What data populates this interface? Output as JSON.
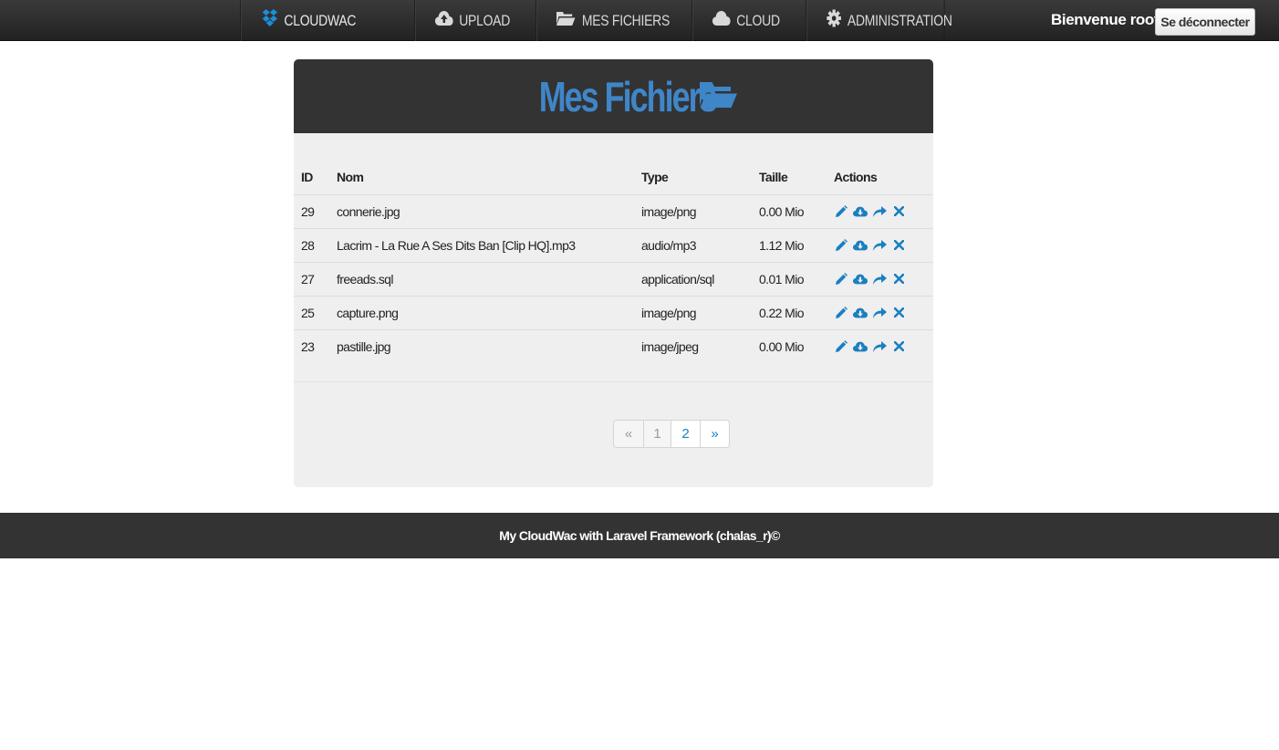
{
  "nav": {
    "brand": "CLOUDWAC",
    "items": [
      {
        "label": "UPLOAD",
        "icon": "cloud-upload-icon"
      },
      {
        "label": "MES FICHIERS",
        "icon": "folder-open-icon"
      },
      {
        "label": "CLOUD",
        "icon": "cloud-icon"
      },
      {
        "label": "ADMINISTRATION",
        "icon": "gear-icon"
      }
    ],
    "welcome": "Bienvenue root",
    "logout_label": "Se déconnecter"
  },
  "colors": {
    "navbar_bg": "#2b2b2b",
    "accent_blue": "#3f86c9",
    "action_blue": "#1a7fc1",
    "brand_blue": "#1a8fd8",
    "panel_bg": "#efefef",
    "header_bg": "#333333"
  },
  "page": {
    "title": "Mes Fichiers",
    "title_icon": "folder-open-icon"
  },
  "table": {
    "headers": [
      "ID",
      "Nom",
      "Type",
      "Taille",
      "Actions"
    ],
    "rows": [
      {
        "id": "29",
        "name": "connerie.jpg",
        "type": "image/png",
        "size": "0.00 Mio"
      },
      {
        "id": "28",
        "name": "Lacrim - La Rue A Ses Dits Ban [Clip HQ].mp3",
        "type": "audio/mp3",
        "size": "1.12 Mio"
      },
      {
        "id": "27",
        "name": "freeads.sql",
        "type": "application/sql",
        "size": "0.01 Mio"
      },
      {
        "id": "25",
        "name": "capture.png",
        "type": "image/png",
        "size": "0.22 Mio"
      },
      {
        "id": "23",
        "name": "pastille.jpg",
        "type": "image/jpeg",
        "size": "0.00 Mio"
      }
    ],
    "action_icons": [
      "pencil-icon",
      "cloud-download-icon",
      "share-icon",
      "delete-icon"
    ]
  },
  "pagination": {
    "prev": "«",
    "pages": [
      "1",
      "2"
    ],
    "next": "»",
    "current": "1"
  },
  "footer": {
    "text": "My CloudWac with Laravel Framework  (chalas_r)©"
  }
}
